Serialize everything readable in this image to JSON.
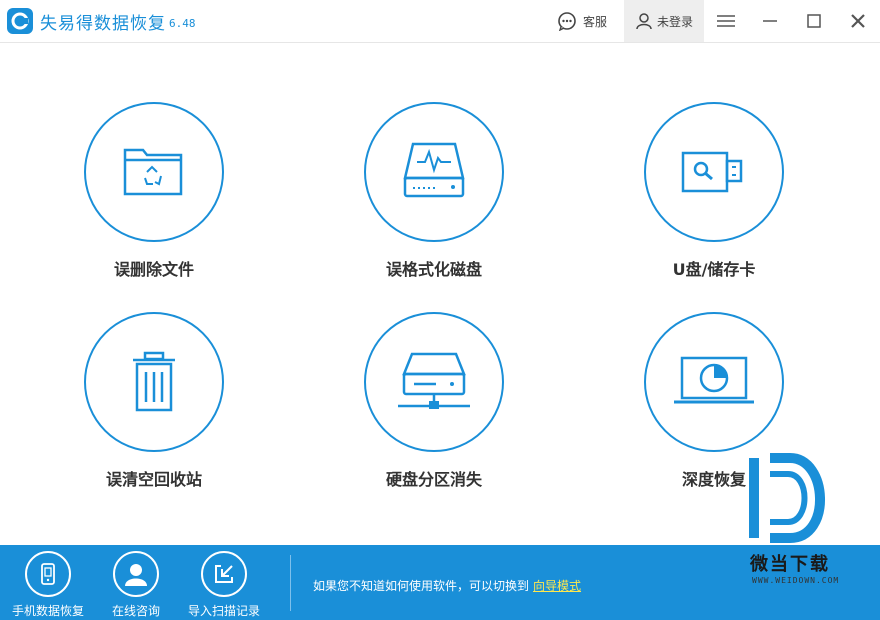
{
  "app": {
    "title": "失易得数据恢复",
    "version": "6.48"
  },
  "header": {
    "service_label": "客服",
    "login_label": "未登录"
  },
  "features": [
    {
      "label": "误删除文件",
      "icon": "folder-recycle-icon"
    },
    {
      "label": "误格式化磁盘",
      "icon": "drive-pulse-icon"
    },
    {
      "label": "U盘/储存卡",
      "icon": "usb-search-icon"
    },
    {
      "label": "误清空回收站",
      "icon": "trash-icon"
    },
    {
      "label": "硬盘分区消失",
      "icon": "network-drive-icon"
    },
    {
      "label": "深度恢复",
      "icon": "laptop-scan-icon"
    }
  ],
  "bottom": {
    "items": [
      {
        "label": "手机数据恢复",
        "icon": "phone-icon"
      },
      {
        "label": "在线咨询",
        "icon": "user-icon"
      },
      {
        "label": "导入扫描记录",
        "icon": "import-icon"
      }
    ],
    "hint_text": "如果您不知道如何使用软件，可以切换到",
    "hint_link": "向导模式"
  },
  "watermark": {
    "text": "微当下载",
    "sub": "WWW.WEIDOWN.COM"
  },
  "colors": {
    "accent": "#1a8fd8",
    "link": "#ffe84d"
  }
}
